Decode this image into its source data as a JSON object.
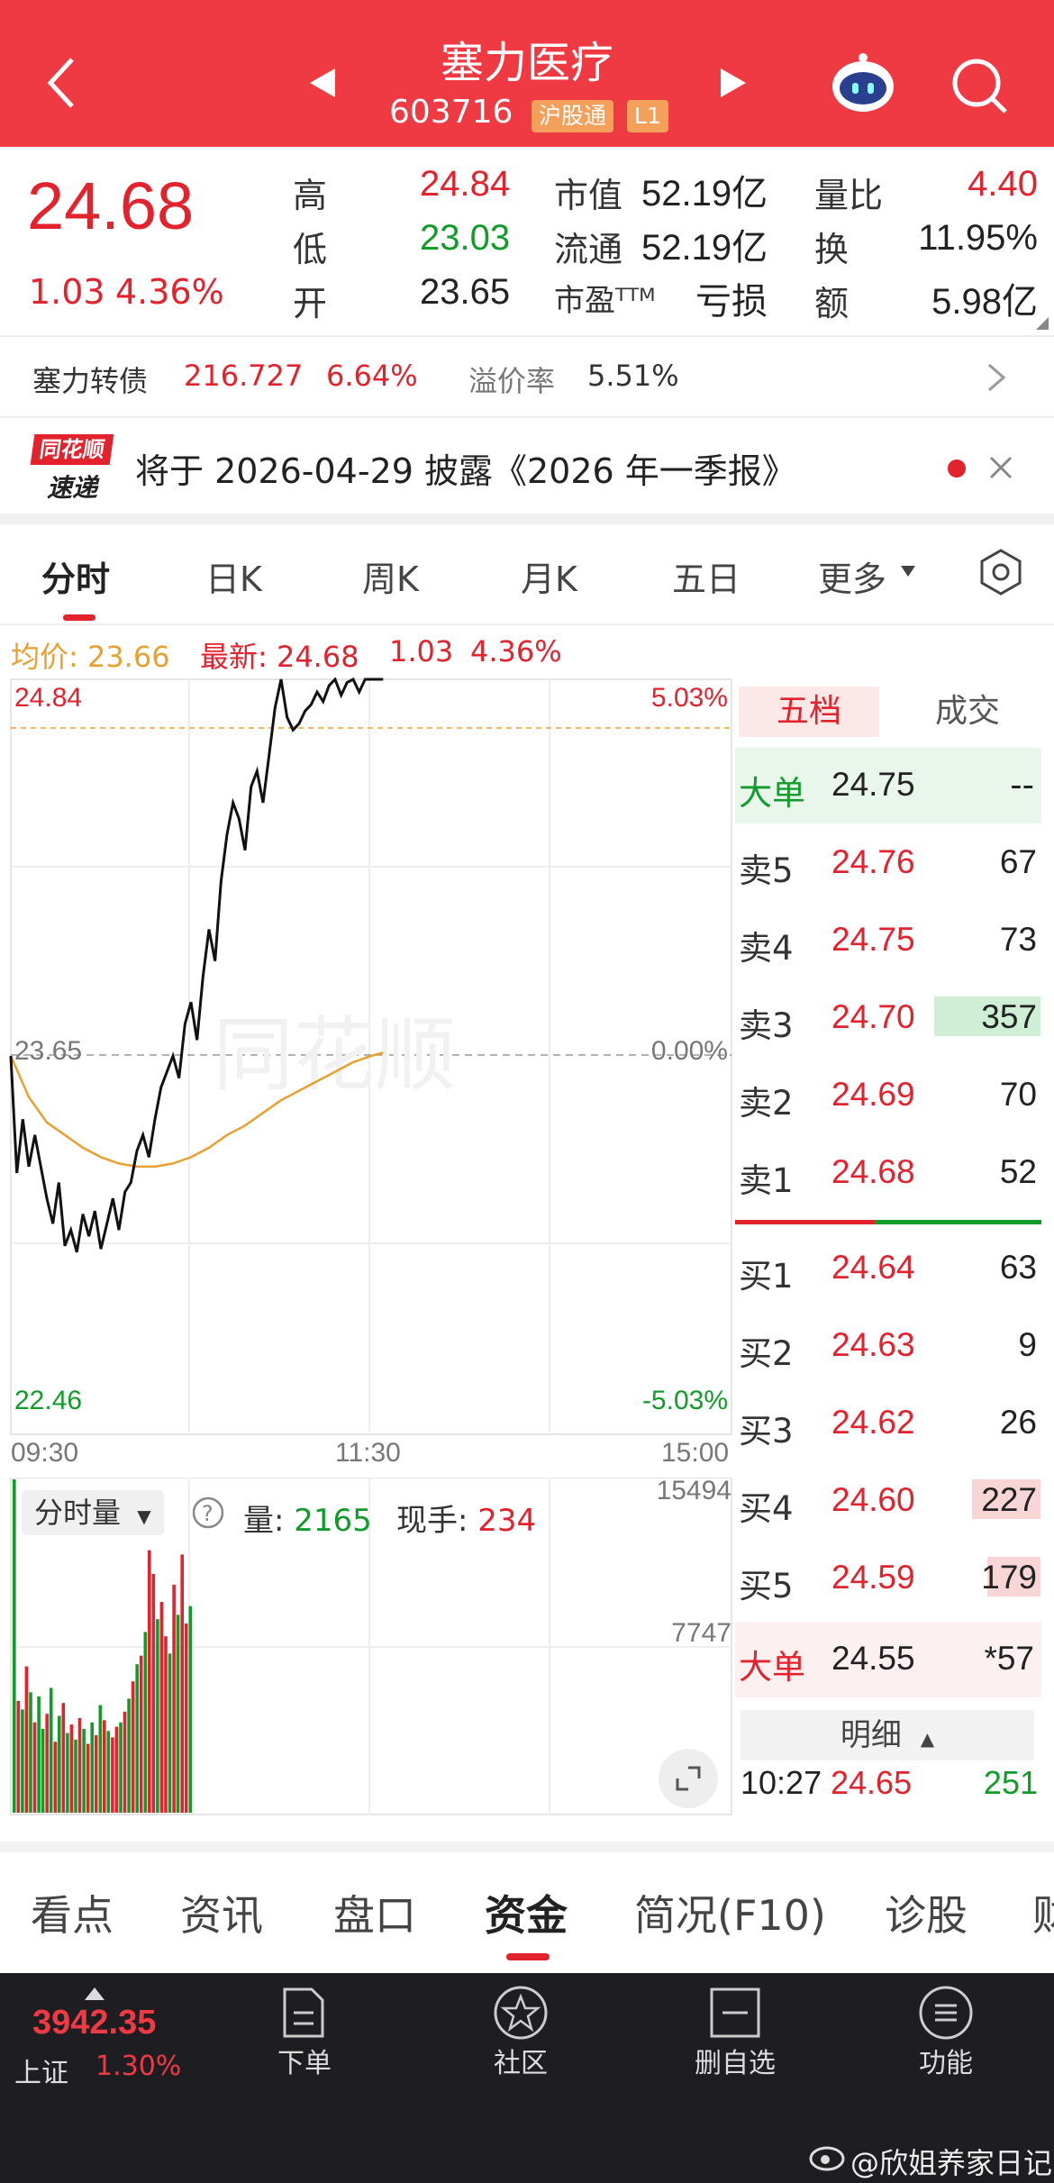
{
  "header": {
    "stock_name": "塞力医疗",
    "stock_code": "603716",
    "tag_connect": "沪股通",
    "tag_level": "L1"
  },
  "quote": {
    "price": "24.68",
    "change": "1.03",
    "change_pct": "4.36%",
    "high_label": "高",
    "high": "24.84",
    "low_label": "低",
    "low": "23.03",
    "open_label": "开",
    "open": "23.65",
    "mktcap_label": "市值",
    "mktcap": "52.19亿",
    "float_label": "流通",
    "float": "52.19亿",
    "pe_label": "市盈ᵀᵀᴹ",
    "pe": "亏损",
    "volratio_label": "量比",
    "volratio": "4.40",
    "turnover_label": "换",
    "turnover": "11.95%",
    "amount_label": "额",
    "amount": "5.98亿"
  },
  "bond": {
    "name": "塞力转债",
    "price": "216.727",
    "change_pct": "6.64%",
    "premium_label": "溢价率",
    "premium": "5.51%"
  },
  "notice": {
    "logo_top": "同花顺",
    "logo_bottom": "速递",
    "text": "将于 2026-04-29 披露《2026 年一季报》"
  },
  "chart_tabs": [
    "分时",
    "日K",
    "周K",
    "月K",
    "五日",
    "更多"
  ],
  "legend": {
    "avg_label": "均价: 23.66",
    "latest_label": "最新: 24.68",
    "change": "1.03",
    "change_pct": "4.36%"
  },
  "price_axis": {
    "top": "24.84",
    "mid": "23.65",
    "bottom": "22.46",
    "top_pct": "5.03%",
    "mid_pct": "0.00%",
    "bottom_pct": "-5.03%"
  },
  "time_axis": [
    "09:30",
    "11:30",
    "15:00"
  ],
  "watermark": "同花顺",
  "chart_data": {
    "type": "line",
    "x_unit": "minutes since 09:30",
    "ylim": [
      22.46,
      24.84
    ],
    "series": [
      {
        "name": "最新",
        "color": "#111111",
        "x": [
          0,
          2,
          4,
          6,
          8,
          10,
          12,
          14,
          16,
          18,
          20,
          22,
          24,
          26,
          28,
          30,
          32,
          34,
          36,
          38,
          40,
          42,
          44,
          46,
          48,
          50,
          52,
          54,
          56,
          58,
          60,
          62,
          64,
          66,
          68,
          70,
          72,
          74,
          76,
          78,
          80,
          82,
          84,
          86,
          88,
          90,
          92,
          94,
          96,
          98,
          100,
          102,
          104,
          106,
          108,
          110,
          112,
          114,
          116,
          118,
          120,
          122,
          124
        ],
        "y": [
          23.65,
          23.28,
          23.45,
          23.3,
          23.4,
          23.3,
          23.2,
          23.12,
          23.25,
          23.05,
          23.1,
          23.03,
          23.15,
          23.08,
          23.16,
          23.04,
          23.12,
          23.2,
          23.1,
          23.22,
          23.25,
          23.35,
          23.4,
          23.33,
          23.45,
          23.55,
          23.6,
          23.65,
          23.58,
          23.75,
          23.82,
          23.7,
          23.9,
          24.05,
          23.95,
          24.2,
          24.35,
          24.45,
          24.4,
          24.3,
          24.5,
          24.55,
          24.45,
          24.6,
          24.75,
          24.84,
          24.72,
          24.68,
          24.7,
          24.74,
          24.76,
          24.8,
          24.77,
          24.82,
          24.84,
          24.79,
          24.83,
          24.84,
          24.8,
          24.84,
          24.84,
          24.84,
          24.84
        ]
      },
      {
        "name": "均价",
        "color": "#e8a030",
        "x": [
          0,
          6,
          12,
          18,
          24,
          30,
          36,
          42,
          48,
          54,
          60,
          66,
          72,
          78,
          84,
          90,
          96,
          102,
          108,
          114,
          120,
          124
        ],
        "y": [
          23.65,
          23.52,
          23.44,
          23.4,
          23.36,
          23.33,
          23.31,
          23.3,
          23.3,
          23.31,
          23.33,
          23.36,
          23.4,
          23.43,
          23.47,
          23.51,
          23.54,
          23.57,
          23.6,
          23.63,
          23.65,
          23.66
        ]
      }
    ]
  },
  "volume": {
    "selector": "分时量",
    "volume_label": "量: ",
    "volume": "2165",
    "hand_label": "现手: ",
    "hand": "234",
    "axis_top": "15494",
    "axis_mid": "7747",
    "bars": [
      {
        "v": 15494,
        "c": "g"
      },
      {
        "v": 5200,
        "c": "r"
      },
      {
        "v": 4800,
        "c": "g"
      },
      {
        "v": 6800,
        "c": "r"
      },
      {
        "v": 5600,
        "c": "g"
      },
      {
        "v": 4200,
        "c": "r"
      },
      {
        "v": 5400,
        "c": "g"
      },
      {
        "v": 3900,
        "c": "g"
      },
      {
        "v": 4600,
        "c": "r"
      },
      {
        "v": 5800,
        "c": "g"
      },
      {
        "v": 3300,
        "c": "r"
      },
      {
        "v": 4500,
        "c": "g"
      },
      {
        "v": 5100,
        "c": "r"
      },
      {
        "v": 3700,
        "c": "g"
      },
      {
        "v": 4100,
        "c": "r"
      },
      {
        "v": 3400,
        "c": "g"
      },
      {
        "v": 4400,
        "c": "r"
      },
      {
        "v": 3900,
        "c": "g"
      },
      {
        "v": 3200,
        "c": "r"
      },
      {
        "v": 4200,
        "c": "g"
      },
      {
        "v": 3600,
        "c": "r"
      },
      {
        "v": 5000,
        "c": "g"
      },
      {
        "v": 4300,
        "c": "r"
      },
      {
        "v": 3800,
        "c": "g"
      },
      {
        "v": 3500,
        "c": "r"
      },
      {
        "v": 4000,
        "c": "r"
      },
      {
        "v": 4200,
        "c": "g"
      },
      {
        "v": 4700,
        "c": "r"
      },
      {
        "v": 5300,
        "c": "g"
      },
      {
        "v": 6100,
        "c": "r"
      },
      {
        "v": 6900,
        "c": "g"
      },
      {
        "v": 7300,
        "c": "r"
      },
      {
        "v": 8400,
        "c": "g"
      },
      {
        "v": 12200,
        "c": "r"
      },
      {
        "v": 11100,
        "c": "r"
      },
      {
        "v": 9000,
        "c": "g"
      },
      {
        "v": 9800,
        "c": "r"
      },
      {
        "v": 8200,
        "c": "r"
      },
      {
        "v": 7400,
        "c": "g"
      },
      {
        "v": 10600,
        "c": "r"
      },
      {
        "v": 9200,
        "c": "g"
      },
      {
        "v": 12000,
        "c": "r"
      },
      {
        "v": 8800,
        "c": "r"
      },
      {
        "v": 9600,
        "c": "g"
      }
    ]
  },
  "orderbook": {
    "tab_active": "五档",
    "tab_other": "成交",
    "big_sell_label": "大单",
    "big_sell_price": "24.75",
    "big_sell_vol": "--",
    "asks": [
      {
        "label": "卖5",
        "price": "24.76",
        "vol": "67",
        "bar": 0.0
      },
      {
        "label": "卖4",
        "price": "24.75",
        "vol": "73",
        "bar": 0.0
      },
      {
        "label": "卖3",
        "price": "24.70",
        "vol": "357",
        "bar": 1.0
      },
      {
        "label": "卖2",
        "price": "24.69",
        "vol": "70",
        "bar": 0.0
      },
      {
        "label": "卖1",
        "price": "24.68",
        "vol": "52",
        "bar": 0.0
      }
    ],
    "bids": [
      {
        "label": "买1",
        "price": "24.64",
        "vol": "63",
        "bar": 0.0
      },
      {
        "label": "买2",
        "price": "24.63",
        "vol": "9",
        "bar": 0.0
      },
      {
        "label": "买3",
        "price": "24.62",
        "vol": "26",
        "bar": 0.0
      },
      {
        "label": "买4",
        "price": "24.60",
        "vol": "227",
        "bar": 0.64
      },
      {
        "label": "买5",
        "price": "24.59",
        "vol": "179",
        "bar": 0.5
      }
    ],
    "big_buy_label": "大单",
    "big_buy_price": "24.55",
    "big_buy_vol": "*57",
    "detail_label": "明细",
    "detail_time": "10:27",
    "detail_price": "24.65",
    "detail_vol": "251"
  },
  "bottom_tabs": [
    "看点",
    "资讯",
    "盘口",
    "资金",
    "简况(F10)",
    "诊股",
    "财"
  ],
  "nav": {
    "index_value": "3942.35",
    "index_name": "上证",
    "index_pct": "1.30%",
    "order": "下单",
    "community": "社区",
    "del_watch": "删自选",
    "functions": "功能",
    "watermark": "@欣姐养家日记"
  }
}
